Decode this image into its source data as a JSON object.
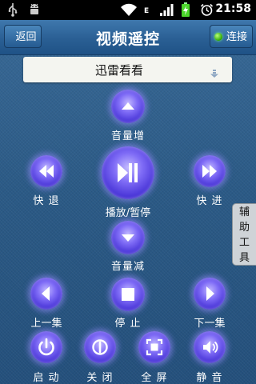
{
  "status_bar": {
    "time": "21:58",
    "network_type": "E",
    "icons": [
      "usb-icon",
      "android-debug-icon",
      "wifi-icon",
      "signal-icon",
      "battery-charging-icon",
      "alarm-icon"
    ]
  },
  "header": {
    "back_label": "返回",
    "title": "视频遥控",
    "connect_label": "连接"
  },
  "player_select": {
    "selected": "迅雷看看"
  },
  "side_tab": {
    "label_line1": "辅助",
    "label_line2": "工具"
  },
  "controls": {
    "volume_up": "音量增",
    "rewind": "快 退",
    "play_pause": "播放/暂停",
    "fast_forward": "快 进",
    "volume_down": "音量减",
    "previous": "上一集",
    "stop": "停 止",
    "next": "下一集",
    "power_on": "启 动",
    "close": "关 闭",
    "fullscreen": "全 屏",
    "mute": "静 音"
  },
  "colors": {
    "background": "#2d5a86",
    "header": "#2a5f94",
    "button_glow": "#7f6cf6",
    "connected_led": "#2ea800"
  }
}
